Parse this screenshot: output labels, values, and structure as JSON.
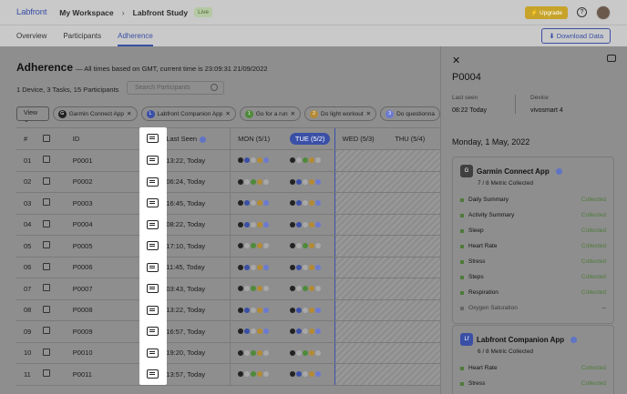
{
  "header": {
    "brand": "Labfront",
    "workspace": "My Workspace",
    "separator": "›",
    "study": "Labfront Study",
    "status_badge": "Live",
    "upgrade_label": "⚡ Upgrade",
    "help_label": "?"
  },
  "tabs": [
    {
      "label": "Overview",
      "active": false
    },
    {
      "label": "Participants",
      "active": false
    },
    {
      "label": "Adherence",
      "active": true
    }
  ],
  "download_label": "⬇ Download Data",
  "main": {
    "title": "Adherence",
    "subtitle": "— All times based on GMT, current time is 23:09:31 21/09/2022",
    "counts": "1 Device, 3 Tasks, 15 Participants",
    "search_placeholder": "Search Participants"
  },
  "filters": {
    "view_label": "View ⌄",
    "chips": [
      {
        "icon": "G",
        "label": "Garmin Connect App"
      },
      {
        "icon": "L",
        "label": "Labfront Companion App"
      },
      {
        "icon": "1",
        "label": "Go for a run"
      },
      {
        "icon": "2",
        "label": "Do light workout"
      },
      {
        "icon": "3",
        "label": "Do questionna"
      }
    ]
  },
  "table": {
    "headers": {
      "num": "#",
      "id": "ID",
      "last_seen": "Last Seen",
      "mon": "MON (5/1)",
      "tue": "TUE (5/2)",
      "wed": "WED (5/3)",
      "thu": "THU (5/4)"
    },
    "rows": [
      {
        "num": "01",
        "id": "P0001",
        "last": "13:22, Today"
      },
      {
        "num": "02",
        "id": "P0002",
        "last": "06:24, Today"
      },
      {
        "num": "03",
        "id": "P0003",
        "last": "16:45, Today"
      },
      {
        "num": "04",
        "id": "P0004",
        "last": "08:22, Today"
      },
      {
        "num": "05",
        "id": "P0005",
        "last": "17:10, Today"
      },
      {
        "num": "06",
        "id": "P0006",
        "last": "11:45, Today"
      },
      {
        "num": "07",
        "id": "P0007",
        "last": "03:43, Today"
      },
      {
        "num": "08",
        "id": "P0008",
        "last": "13:22, Today"
      },
      {
        "num": "09",
        "id": "P0009",
        "last": "16:57, Today"
      },
      {
        "num": "10",
        "id": "P0010",
        "last": "19:20, Today"
      },
      {
        "num": "11",
        "id": "P0011",
        "last": "13:57, Today"
      }
    ]
  },
  "panel": {
    "close": "✕",
    "participant_id": "P0004",
    "last_seen_label": "Last seen",
    "last_seen_value": "08:22 Today",
    "device_label": "Device",
    "device_value": "vivosmart 4",
    "date": "Monday, 1 May, 2022",
    "apps": [
      {
        "logo": "G",
        "name": "Garmin Connect App",
        "count": "7 / 8 Metric Collected",
        "metrics": [
          {
            "name": "Daily Summary",
            "status": "Collected"
          },
          {
            "name": "Activity Summary",
            "status": "Collected"
          },
          {
            "name": "Sleep",
            "status": "Collected"
          },
          {
            "name": "Heart Rate",
            "status": "Collected"
          },
          {
            "name": "Stress",
            "status": "Collected"
          },
          {
            "name": "Steps",
            "status": "Collected"
          },
          {
            "name": "Respiration",
            "status": "Collected"
          },
          {
            "name": "Oxygen Saturation",
            "status": "--"
          }
        ]
      },
      {
        "logo": "Lf",
        "name": "Labfront Companion App",
        "count": "6 / 8 Metric Collected",
        "metrics": [
          {
            "name": "Heart Rate",
            "status": "Collected"
          },
          {
            "name": "Stress",
            "status": "Collected"
          }
        ]
      }
    ]
  }
}
